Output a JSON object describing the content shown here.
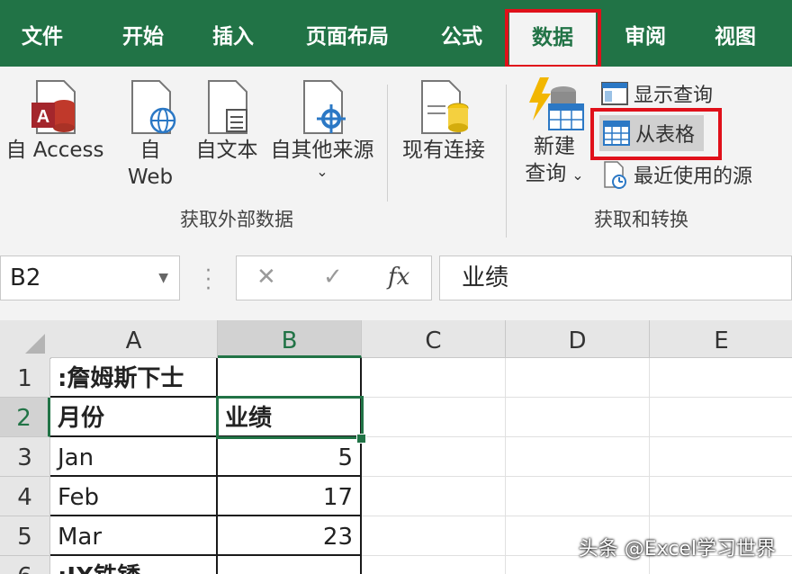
{
  "tabs": [
    "文件",
    "开始",
    "插入",
    "页面布局",
    "公式",
    "数据",
    "审阅",
    "视图"
  ],
  "active_tab": "数据",
  "ribbon": {
    "get_external": {
      "buttons": [
        {
          "label1": "自 Access",
          "label2": "",
          "icon": "access-db-icon"
        },
        {
          "label1": "自",
          "label2": "Web",
          "icon": "web-globe-icon"
        },
        {
          "label1": "自文本",
          "label2": "",
          "icon": "text-file-icon"
        },
        {
          "label1": "自其他来源",
          "label2": "⌄",
          "icon": "other-source-icon"
        },
        {
          "label1": "现有连接",
          "label2": "",
          "icon": "existing-connection-icon"
        }
      ],
      "group_label": "获取外部数据"
    },
    "transform": {
      "new_query_line1": "新建",
      "new_query_line2": "查询",
      "new_query_caret": "⌄",
      "show_queries": "显示查询",
      "from_table": "从表格",
      "recent_sources": "最近使用的源",
      "group_label": "获取和转换"
    }
  },
  "formula_bar": {
    "name_box": "B2",
    "cancel": "✕",
    "enter": "✓",
    "fx": "fx",
    "content": "业绩"
  },
  "grid": {
    "columns": [
      "A",
      "B",
      "C",
      "D",
      "E"
    ],
    "rows": [
      "1",
      "2",
      "3",
      "4",
      "5",
      "6"
    ],
    "cells": {
      "A1": ":詹姆斯下士",
      "B1": "",
      "A2": "月份",
      "B2": "业绩",
      "A3": "Jan",
      "B3": "5",
      "A4": "Feb",
      "B4": "17",
      "A5": "Mar",
      "B5": "23",
      "A6": ":IX铁锈"
    },
    "selected_cell": "B2"
  },
  "watermark": "头条 @Excel学习世界",
  "colors": {
    "excel_green": "#217346",
    "highlight_red": "#e0101a"
  }
}
